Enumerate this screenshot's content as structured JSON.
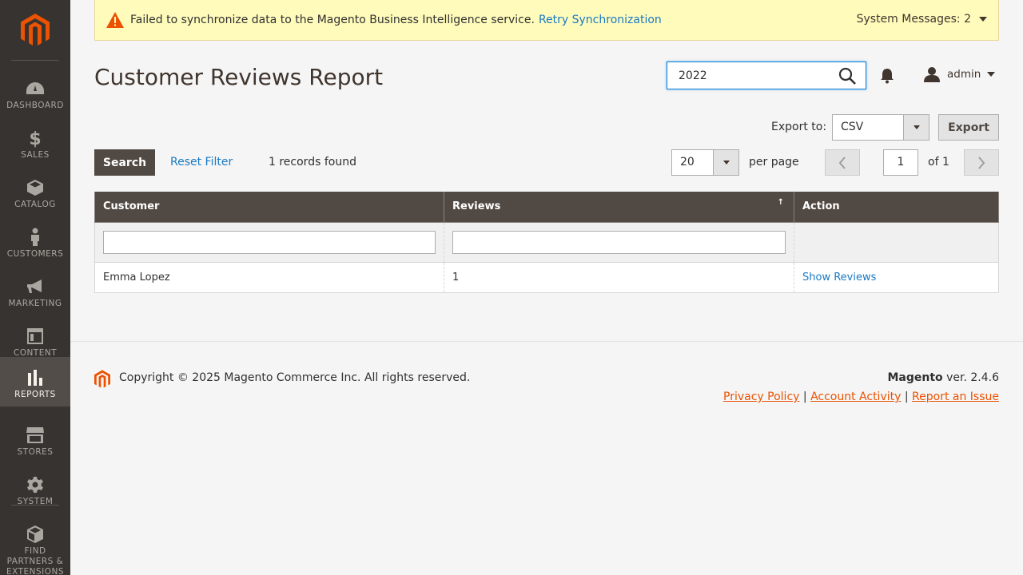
{
  "sidebar": {
    "items": [
      {
        "label": "Dashboard",
        "icon": "dashboard-icon"
      },
      {
        "label": "Sales",
        "icon": "dollar-icon"
      },
      {
        "label": "Catalog",
        "icon": "cube-icon"
      },
      {
        "label": "Customers",
        "icon": "person-icon"
      },
      {
        "label": "Marketing",
        "icon": "megaphone-icon"
      },
      {
        "label": "Content",
        "icon": "layout-icon"
      },
      {
        "label": "Reports",
        "icon": "bar-chart-icon",
        "active": true
      },
      {
        "label": "Stores",
        "icon": "storefront-icon"
      },
      {
        "label": "System",
        "icon": "gear-icon"
      },
      {
        "label": "Find Partners & Extensions",
        "icon": "boxes-icon"
      }
    ]
  },
  "system_message": {
    "text": "Failed to synchronize data to the Magento Business Intelligence service.",
    "link": "Retry Synchronization",
    "count_label": "System Messages: 2"
  },
  "header": {
    "title": "Customer Reviews Report",
    "search_value": "2022",
    "user": "admin"
  },
  "export": {
    "label": "Export to:",
    "format": "CSV",
    "button": "Export"
  },
  "toolbar": {
    "search_button": "Search",
    "reset_filter": "Reset Filter",
    "records_found": "1 records found",
    "per_page_value": "20",
    "per_page_label": "per page",
    "page": "1",
    "of_pages": "of 1"
  },
  "grid": {
    "columns": [
      "Customer",
      "Reviews",
      "Action"
    ],
    "sort_indicator": "↑",
    "rows": [
      {
        "customer": "Emma Lopez",
        "reviews": "1",
        "action": "Show Reviews"
      }
    ]
  },
  "footer": {
    "copyright": "Copyright © 2025 Magento Commerce Inc. All rights reserved.",
    "brand": "Magento",
    "version": " ver. 2.4.6",
    "links": [
      "Privacy Policy",
      "Account Activity",
      "Report an Issue"
    ]
  },
  "colors": {
    "sidebar_bg": "#373330",
    "accent_link": "#1979c3",
    "footer_link": "#eb5202",
    "header_row": "#514943",
    "message_bg": "#fffbbb"
  }
}
